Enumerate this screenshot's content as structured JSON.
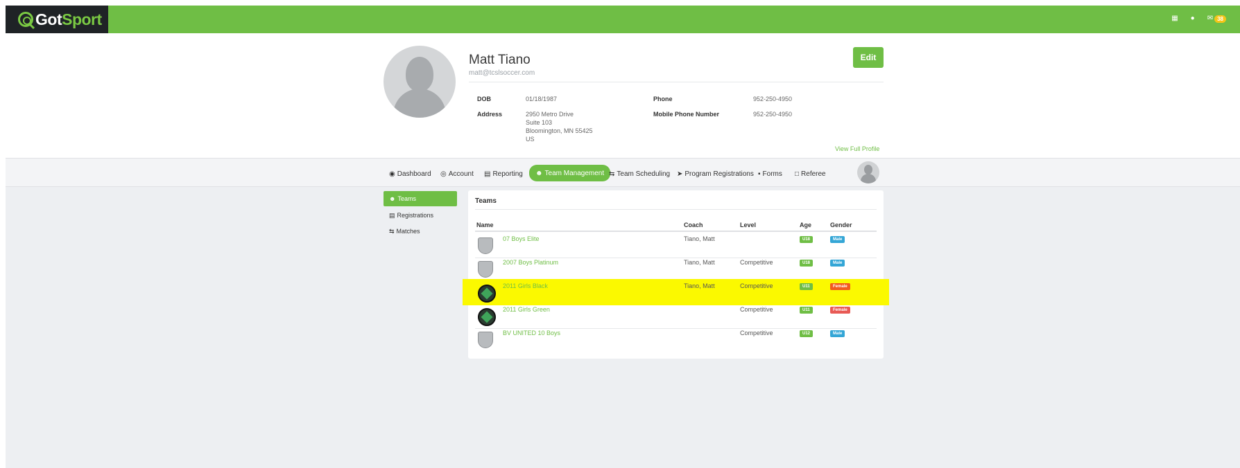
{
  "brand": {
    "got": "Got",
    "sport": "Sport"
  },
  "topbar": {
    "icons": [
      "grid-icon",
      "user-icon",
      "mail-icon"
    ],
    "mail_badge": "38"
  },
  "profile": {
    "name": "Matt Tiano",
    "email": "matt@tcslsoccer.com",
    "edit_label": "Edit",
    "dob_label": "DOB",
    "dob": "01/18/1987",
    "address_label": "Address",
    "address_lines": [
      "2950 Metro Drive",
      "Suite 103",
      "Bloomington, MN 55425",
      "US"
    ],
    "phone_label": "Phone",
    "phone": "952-250-4950",
    "mobile_label": "Mobile Phone Number",
    "mobile": "952-250-4950",
    "view_full": "View Full Profile"
  },
  "nav": {
    "items": [
      {
        "label": "Dashboard",
        "icon": "dashboard-icon"
      },
      {
        "label": "Account",
        "icon": "account-icon"
      },
      {
        "label": "Reporting",
        "icon": "reporting-icon"
      },
      {
        "label": "Team Management",
        "icon": "team-icon",
        "active": true
      },
      {
        "label": "Team Scheduling",
        "icon": "scheduling-icon"
      },
      {
        "label": "Program Registrations",
        "icon": "send-icon"
      },
      {
        "label": "Forms",
        "icon": "forms-icon"
      },
      {
        "label": "Referee",
        "icon": "calendar-icon"
      }
    ]
  },
  "side": {
    "items": [
      {
        "label": "Teams",
        "active": true
      },
      {
        "label": "Registrations"
      },
      {
        "label": "Matches"
      }
    ]
  },
  "teams": {
    "title": "Teams",
    "columns": {
      "name": "Name",
      "coach": "Coach",
      "level": "Level",
      "age": "Age",
      "gender": "Gender"
    },
    "rows": [
      {
        "name": "07 Boys Elite",
        "coach": "Tiano, Matt",
        "level": "",
        "age": "U18",
        "gender": "Male",
        "crest": "shield",
        "highlight": false
      },
      {
        "name": "2007 Boys Platinum",
        "coach": "Tiano, Matt",
        "level": "Competitive",
        "age": "U18",
        "gender": "Male",
        "crest": "shield",
        "highlight": false
      },
      {
        "name": "2011 Girls Black",
        "coach": "Tiano, Matt",
        "level": "Competitive",
        "age": "U11",
        "gender": "Female",
        "crest": "logo",
        "highlight": true
      },
      {
        "name": "2011 Girls Green",
        "coach": "",
        "level": "Competitive",
        "age": "U11",
        "gender": "Female",
        "crest": "logo",
        "highlight": false
      },
      {
        "name": "BV UNITED 10 Boys",
        "coach": "",
        "level": "Competitive",
        "age": "U12",
        "gender": "Male",
        "crest": "shield",
        "highlight": false
      }
    ]
  },
  "colors": {
    "brand_green": "#6fbe45",
    "highlight": "#fbf900",
    "male": "#34a6d6",
    "female": "#e85a55"
  }
}
